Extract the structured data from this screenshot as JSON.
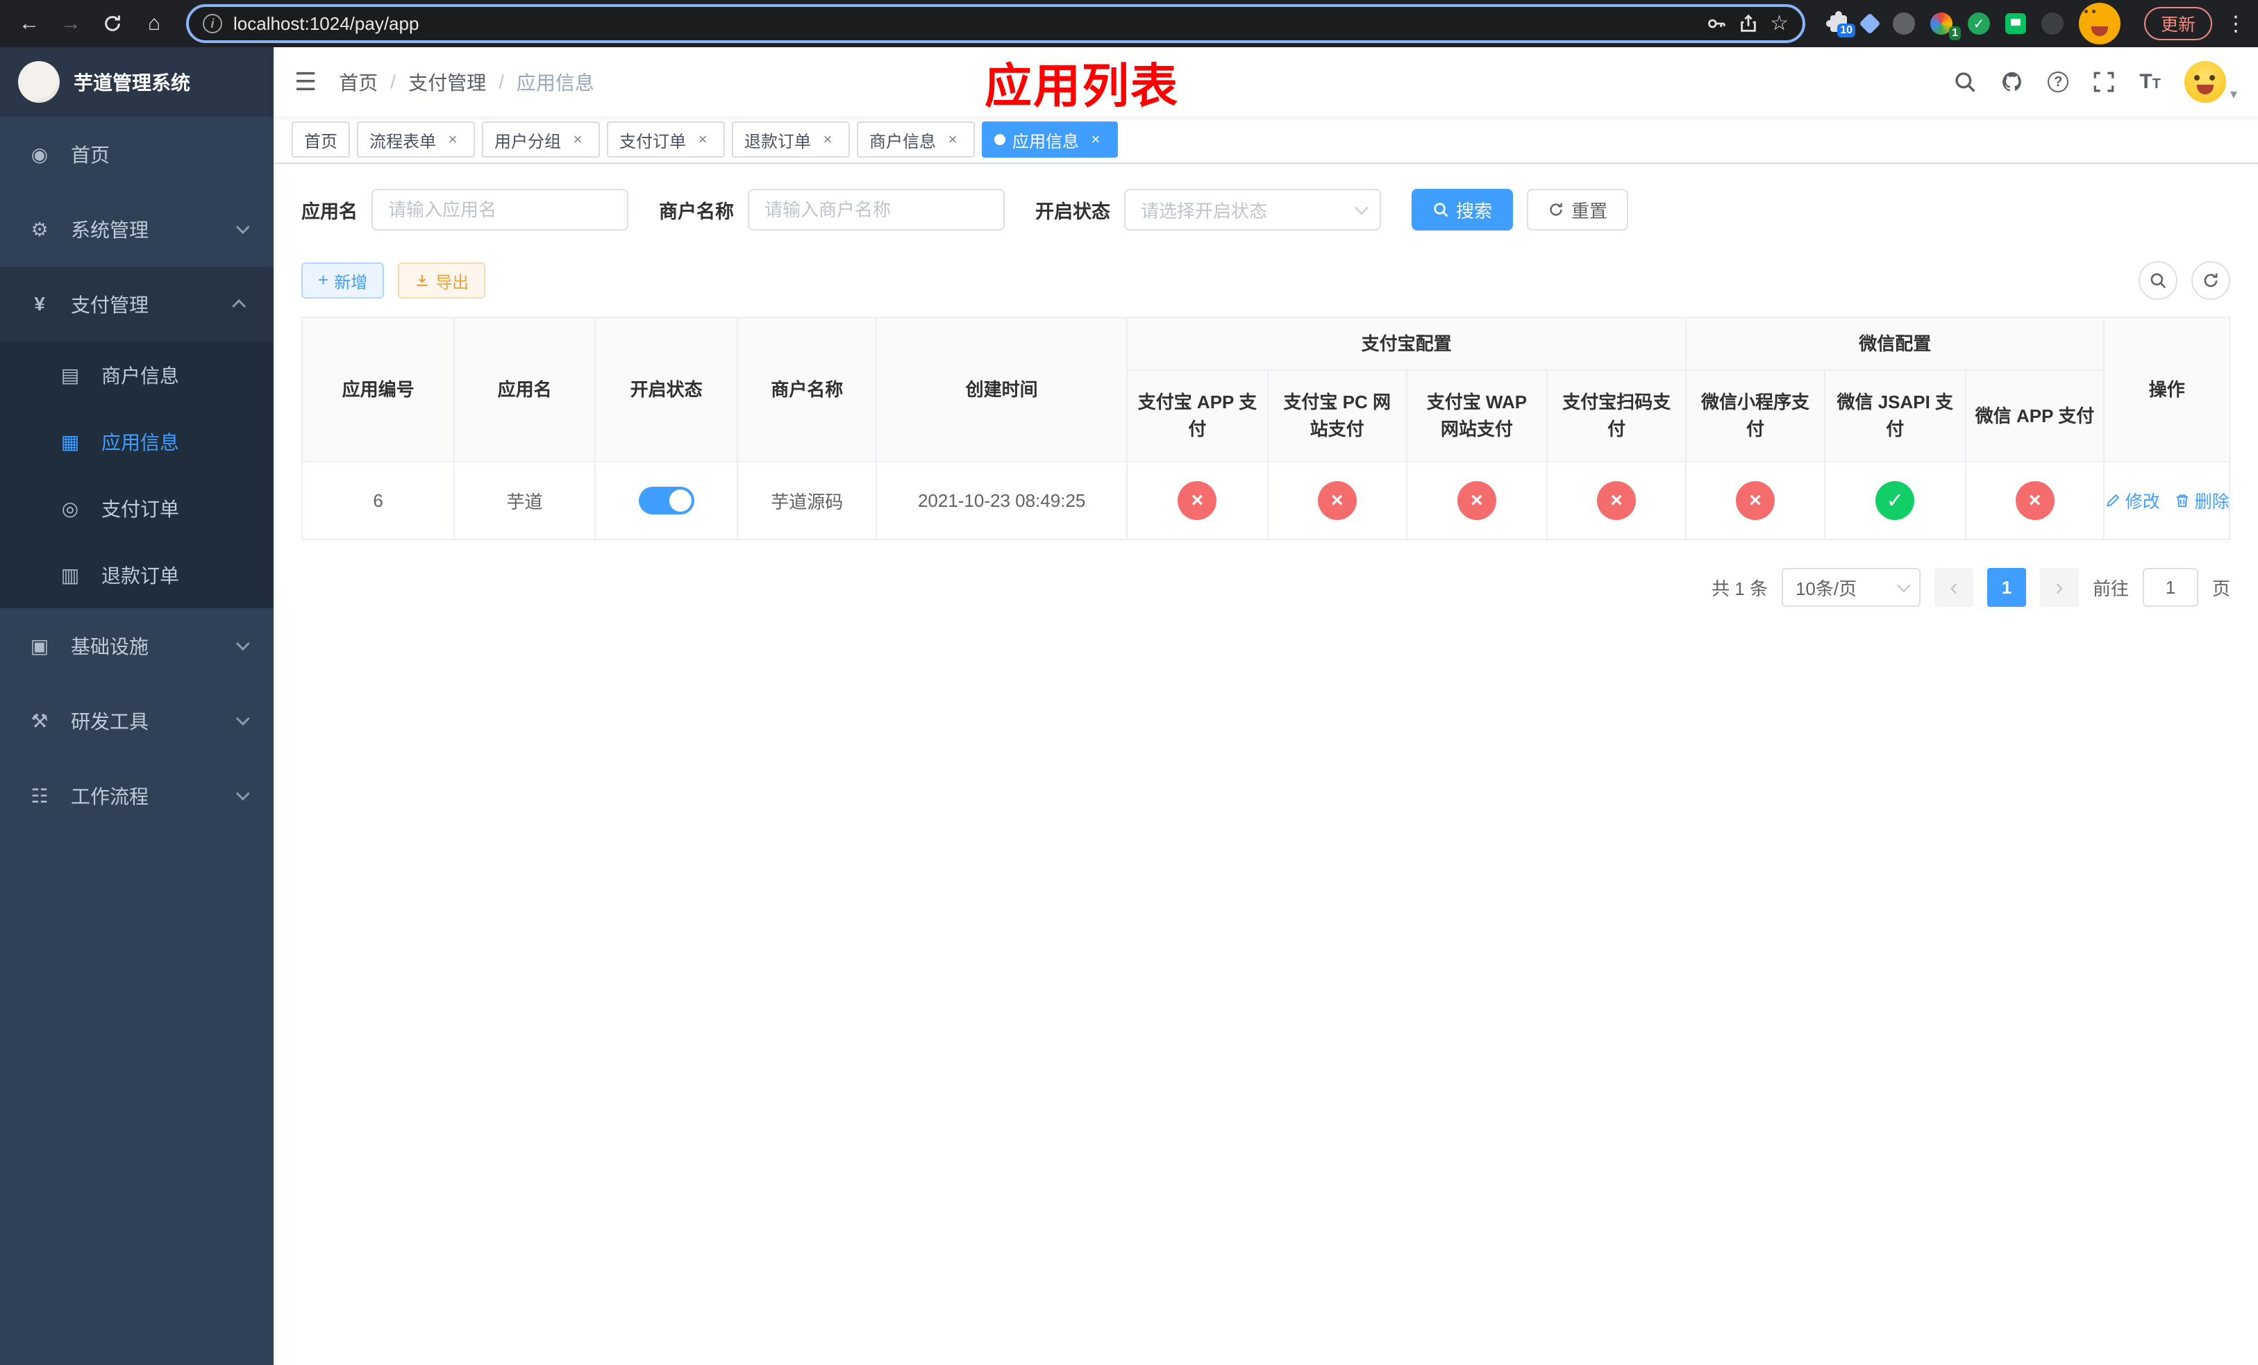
{
  "browser": {
    "url": "localhost:1024/pay/app",
    "update_label": "更新",
    "extensions_badge_primary": "10",
    "extensions_badge_secondary": "1"
  },
  "sidebar": {
    "title": "芋道管理系统",
    "items": [
      {
        "label": "首页",
        "icon": "dashboard"
      },
      {
        "label": "系统管理",
        "icon": "system"
      },
      {
        "label": "支付管理",
        "icon": "payment"
      },
      {
        "label": "基础设施",
        "icon": "infrastructure"
      },
      {
        "label": "研发工具",
        "icon": "devtools"
      },
      {
        "label": "工作流程",
        "icon": "workflow"
      }
    ],
    "payment_children": [
      {
        "label": "商户信息",
        "icon": "merchant",
        "active": false
      },
      {
        "label": "应用信息",
        "icon": "app",
        "active": true
      },
      {
        "label": "支付订单",
        "icon": "order",
        "active": false
      },
      {
        "label": "退款订单",
        "icon": "refund",
        "active": false
      }
    ]
  },
  "header": {
    "breadcrumb": [
      "首页",
      "支付管理",
      "应用信息"
    ],
    "annotation": "应用列表"
  },
  "tabs": [
    {
      "label": "首页",
      "closable": false,
      "active": false
    },
    {
      "label": "流程表单",
      "closable": true,
      "active": false
    },
    {
      "label": "用户分组",
      "closable": true,
      "active": false
    },
    {
      "label": "支付订单",
      "closable": true,
      "active": false
    },
    {
      "label": "退款订单",
      "closable": true,
      "active": false
    },
    {
      "label": "商户信息",
      "closable": true,
      "active": false
    },
    {
      "label": "应用信息",
      "closable": true,
      "active": true
    }
  ],
  "filters": {
    "app_name_label": "应用名",
    "app_name_placeholder": "请输入应用名",
    "merchant_label": "商户名称",
    "merchant_placeholder": "请输入商户名称",
    "status_label": "开启状态",
    "status_placeholder": "请选择开启状态",
    "search_label": "搜索",
    "reset_label": "重置"
  },
  "toolbar": {
    "add_label": "新增",
    "export_label": "导出"
  },
  "table": {
    "simple_headers": [
      "应用编号",
      "应用名",
      "开启状态",
      "商户名称",
      "创建时间"
    ],
    "groups": [
      {
        "label": "支付宝配置",
        "children": [
          "支付宝 APP 支付",
          "支付宝 PC 网站支付",
          "支付宝 WAP 网站支付",
          "支付宝扫码支付"
        ]
      },
      {
        "label": "微信配置",
        "children": [
          "微信小程序支付",
          "微信 JSAPI 支付",
          "微信 APP 支付"
        ]
      }
    ],
    "ops_header": "操作",
    "rows": [
      {
        "id": "6",
        "name": "芋道",
        "status_on": true,
        "merchant": "芋道源码",
        "created": "2021-10-23 08:49:25",
        "configs": [
          "fail",
          "fail",
          "fail",
          "fail",
          "fail",
          "ok",
          "fail"
        ],
        "edit_label": "修改",
        "delete_label": "删除"
      }
    ]
  },
  "pagination": {
    "total": "共 1 条",
    "page_size": "10条/页",
    "page": "1",
    "goto_label": "前往",
    "goto_value": "1",
    "goto_unit": "页"
  },
  "colors": {
    "primary": "#409EFF",
    "danger": "#F56C6C",
    "success": "#13CE66",
    "warning": "#E6A23C",
    "annotation": "#FF0000"
  }
}
